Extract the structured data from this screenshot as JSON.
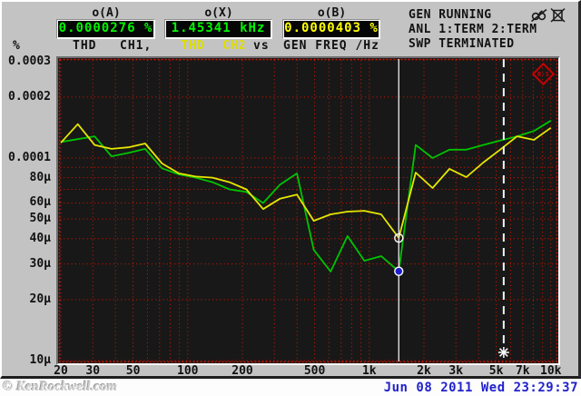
{
  "header": {
    "readouts": [
      {
        "label": "o(A)",
        "value": "0.0000276 %",
        "color": "#00f500"
      },
      {
        "label": "o(X)",
        "value": "1.45341 kHz",
        "color": "#00f500"
      },
      {
        "label": "o(B)",
        "value": "0.0000403 %",
        "color": "#ffff00"
      }
    ],
    "function_row": {
      "unit": "%",
      "ch1_func": "THD",
      "ch1_name": "CH1,",
      "ch2_func": "THD",
      "ch2_name": "CH2",
      "vs": "vs",
      "x_quantity": "GEN FREQ /Hz",
      "ch2_color": "#dede00"
    },
    "status_lines": [
      "GEN RUNNING",
      "ANL 1:TERM 2:TERM",
      "SWP TERMINATED"
    ],
    "icons": [
      "mouse-disabled",
      "monitor-disabled"
    ]
  },
  "footer": {
    "watermark": "© KenRockwell.com",
    "datetime": "Jun 08 2011 Wed 23:29:37"
  },
  "chart_data": {
    "type": "line",
    "title": "THD CH1, THD CH2 vs GEN FREQ /Hz",
    "x_axis": {
      "scale": "log",
      "min": 20,
      "max": 10000,
      "unit": "Hz",
      "tick_labels": [
        "20",
        "30",
        "50",
        "100",
        "200",
        "500",
        "1k",
        "2k",
        "3k",
        "5k",
        "7k",
        "10k"
      ],
      "tick_values": [
        20,
        30,
        50,
        100,
        200,
        500,
        1000,
        2000,
        3000,
        5000,
        7000,
        10000
      ]
    },
    "y_axis": {
      "scale": "log",
      "min": 1e-05,
      "max": 0.0003,
      "unit": "%",
      "tick_labels": [
        "0.0003",
        "0.0002",
        "0.0001",
        "80µ",
        "60µ",
        "50µ",
        "40µ",
        "30µ",
        "20µ",
        "10µ"
      ],
      "tick_values": [
        0.0003,
        0.0002,
        0.0001,
        8e-05,
        6e-05,
        5e-05,
        4e-05,
        3e-05,
        2e-05,
        1e-05
      ]
    },
    "grid": {
      "show": true,
      "color": "#c41400",
      "style": "dotted"
    },
    "plot_background": "#181818",
    "x": [
      20,
      24.8,
      30.7,
      38.0,
      47.1,
      58.3,
      72.2,
      89.4,
      110.7,
      137.1,
      169.8,
      210.3,
      260.4,
      322.5,
      399.4,
      494.6,
      612.6,
      758.6,
      939.5,
      1163.5,
      1453.4,
      1800.7,
      2231,
      2764,
      3423,
      4241,
      5257,
      6513,
      8069,
      10000
    ],
    "series": [
      {
        "name": "THD CH1",
        "color": "#00c400",
        "values": [
          0.00012,
          0.000124,
          0.000128,
          0.000102,
          0.000106,
          0.000111,
          8.9e-05,
          8.3e-05,
          8e-05,
          7.6e-05,
          7e-05,
          6.8e-05,
          6e-05,
          7.4e-05,
          8.4e-05,
          3.52e-05,
          2.75e-05,
          4.12e-05,
          3.11e-05,
          3.28e-05,
          2.76e-05,
          0.000116,
          0.0001,
          0.00011,
          0.00011,
          0.000116,
          0.000122,
          0.000128,
          0.000136,
          0.000153
        ]
      },
      {
        "name": "THD CH2",
        "color": "#e6e600",
        "values": [
          0.000119,
          0.000147,
          0.000116,
          0.000111,
          0.000113,
          0.000118,
          9.4e-05,
          8.4e-05,
          8.1e-05,
          8e-05,
          7.6e-05,
          7e-05,
          5.6e-05,
          6.3e-05,
          6.6e-05,
          4.9e-05,
          5.27e-05,
          5.44e-05,
          5.49e-05,
          5.27e-05,
          4.03e-05,
          8.48e-05,
          7.11e-05,
          8.84e-05,
          8.05e-05,
          9.5e-05,
          0.00011,
          0.000128,
          0.000123,
          0.000141
        ]
      }
    ],
    "cursor": {
      "x_hz": 1453.41,
      "line": "solid-white",
      "markers": [
        {
          "series": "THD CH2",
          "value": 4.03e-05,
          "style": "open-circle"
        },
        {
          "series": "THD CH1",
          "value": 2.76e-05,
          "style": "circle-blue-fill",
          "fill": "#2020cc"
        }
      ]
    },
    "sweep_marker": {
      "x_hz": 5500,
      "line": "dashed-white",
      "symbol": "*"
    }
  }
}
